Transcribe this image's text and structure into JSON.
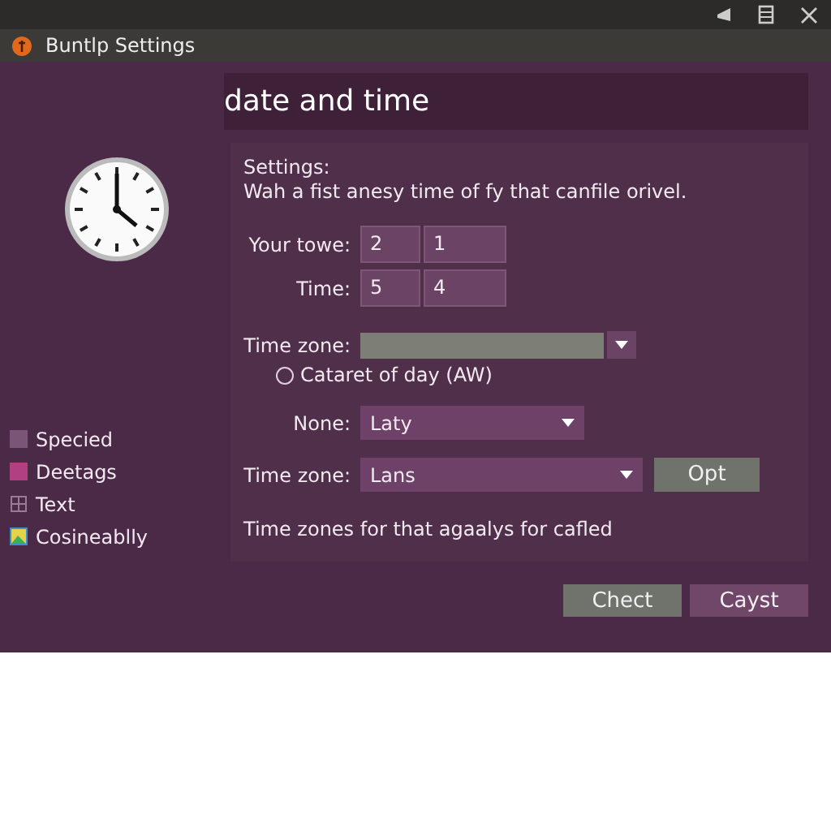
{
  "window": {
    "title": "Buntlp Settings"
  },
  "header": {
    "title": "date and time"
  },
  "intro": {
    "heading": "Settings:",
    "text": "Wah a fist anesy time of fy that canfile orivel."
  },
  "time_rows": [
    {
      "label": "Your towe:",
      "values": [
        "2",
        "1"
      ]
    },
    {
      "label": "Time:",
      "values": [
        "5",
        "4"
      ]
    }
  ],
  "time_zone_1": {
    "label": "Time zone:"
  },
  "radio": {
    "label": "Cataret of day (AW)",
    "selected": false
  },
  "none_select": {
    "label": "None:",
    "value": "Laty"
  },
  "time_zone_2": {
    "label": "Time zone:",
    "value": "Lans",
    "button": "Opt"
  },
  "note": "Time zones for that agaalys for cafled",
  "sidebar": {
    "items": [
      {
        "label": "Specied",
        "kind": "swatch",
        "color": "#7b5577"
      },
      {
        "label": "Deetags",
        "kind": "swatch",
        "color": "#b0407f"
      },
      {
        "label": "Text",
        "kind": "outline"
      },
      {
        "label": "Cosineablly",
        "kind": "image"
      }
    ]
  },
  "buttons": [
    {
      "label": "Chect",
      "kind": "grey"
    },
    {
      "label": "Cayst",
      "kind": "purple"
    }
  ]
}
